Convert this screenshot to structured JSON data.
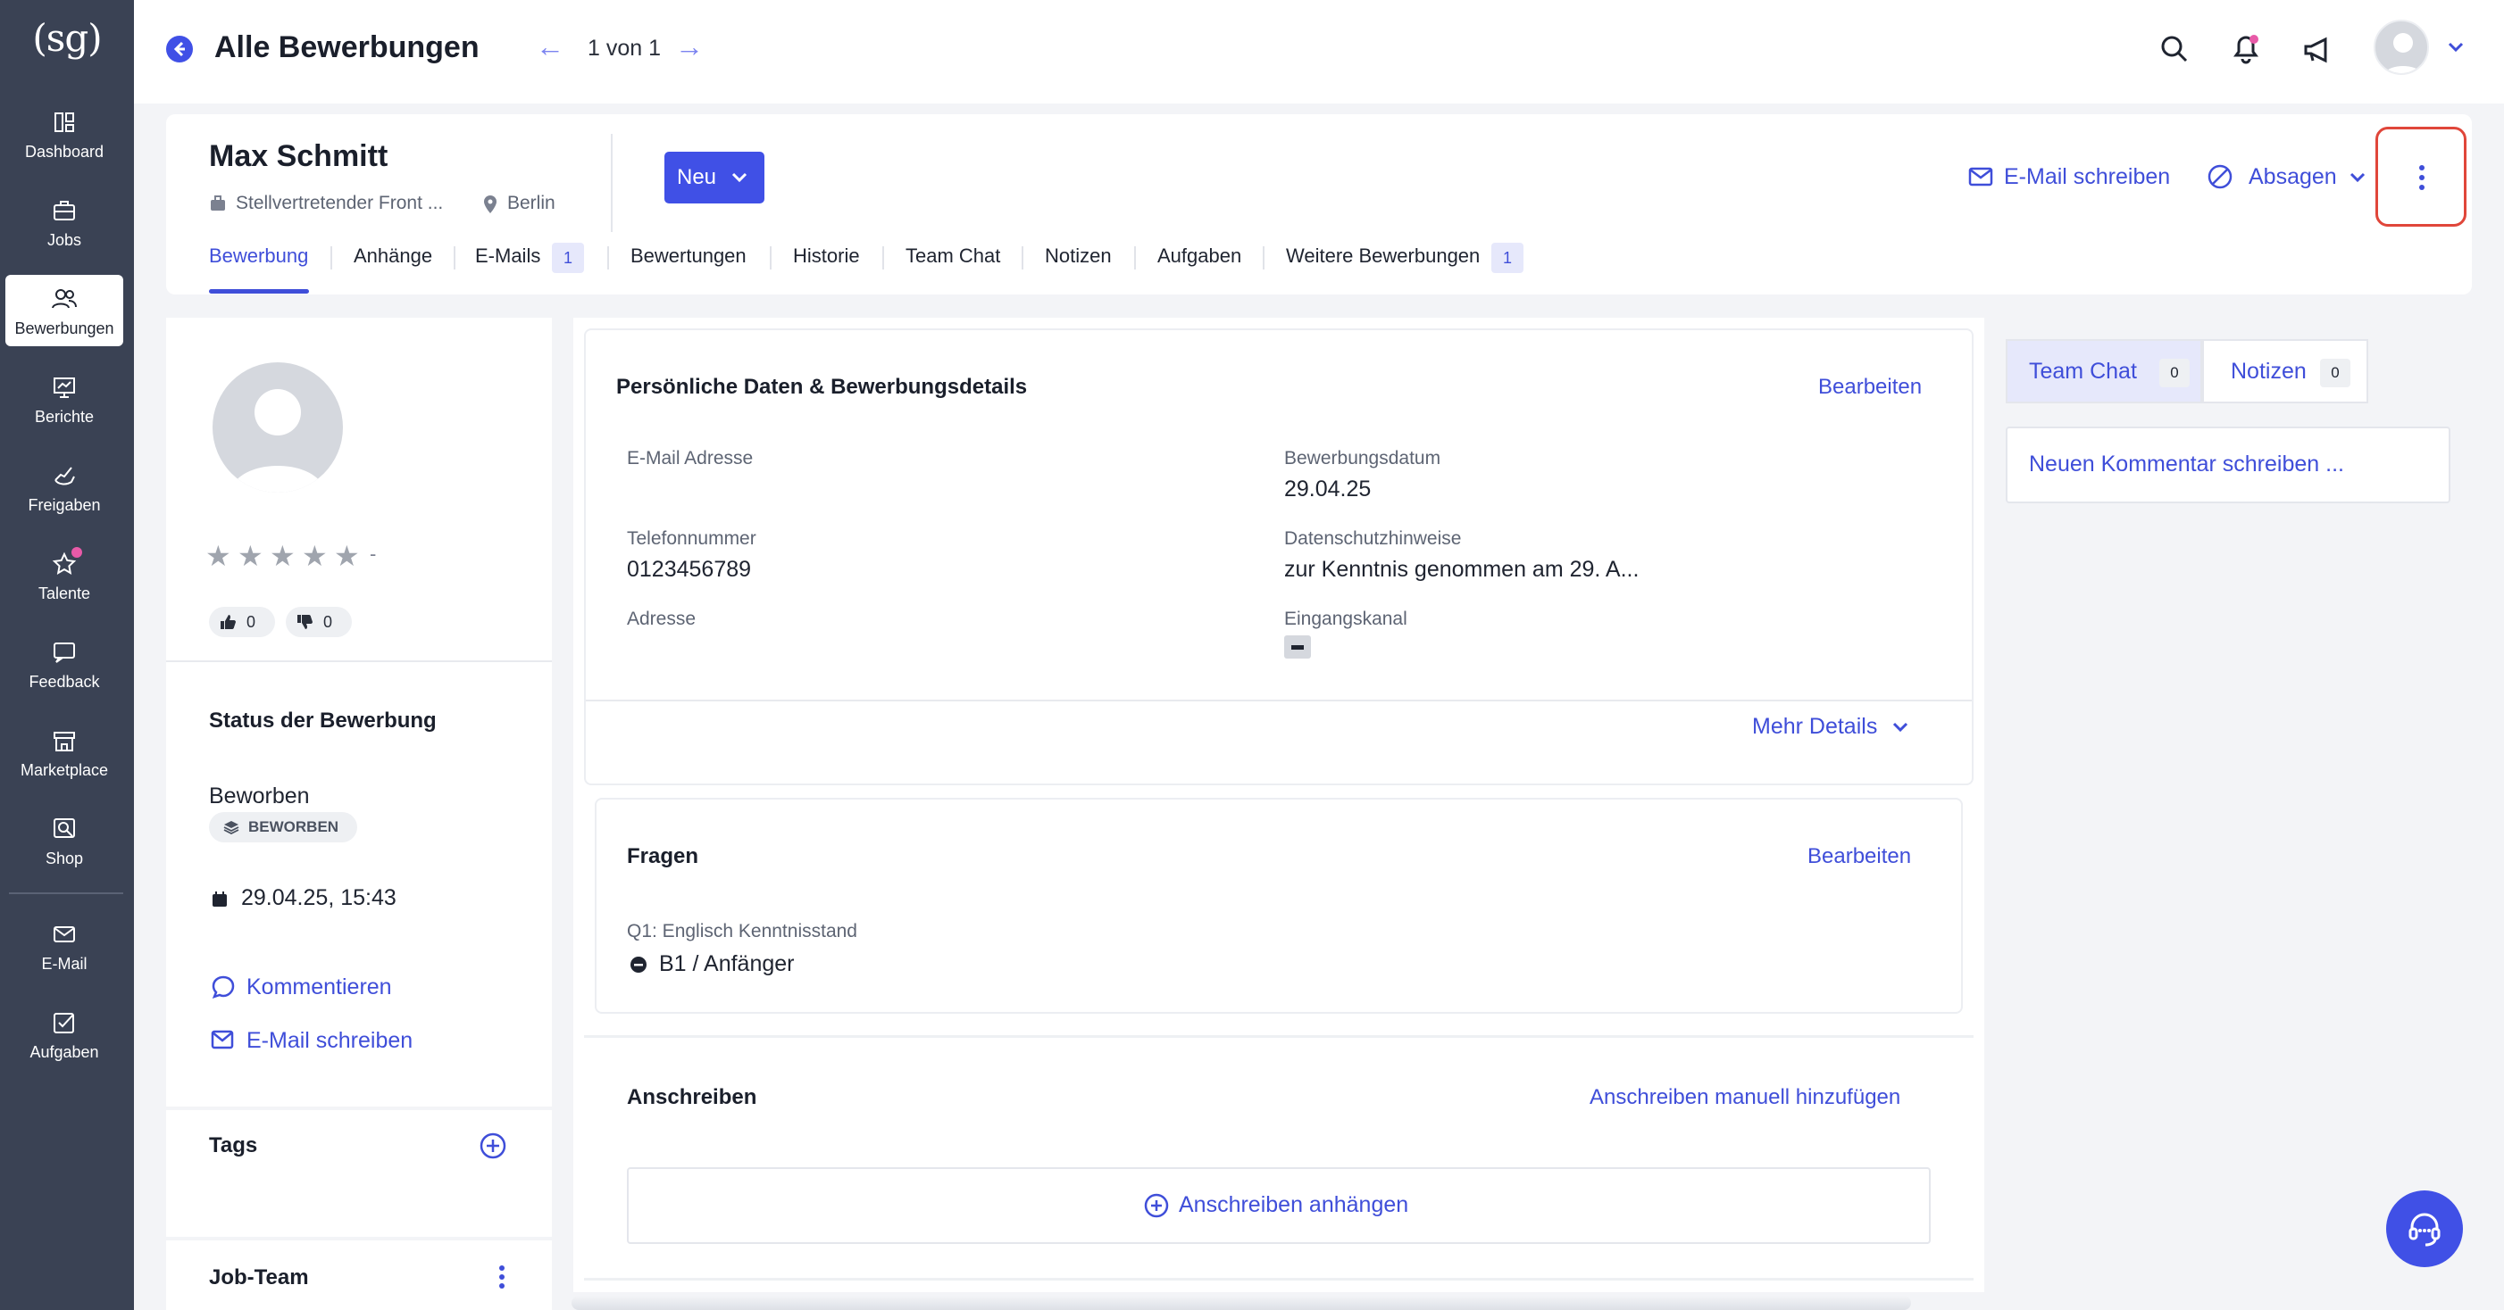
{
  "sidebar": {
    "logo": "(sg)",
    "items": [
      {
        "label": "Dashboard",
        "icon": "dashboard-icon"
      },
      {
        "label": "Jobs",
        "icon": "briefcase-icon"
      },
      {
        "label": "Bewerbungen",
        "icon": "users-icon",
        "active": true
      },
      {
        "label": "Berichte",
        "icon": "chart-icon"
      },
      {
        "label": "Freigaben",
        "icon": "hand-icon"
      },
      {
        "label": "Talente",
        "icon": "star-icon"
      },
      {
        "label": "Feedback",
        "icon": "feedback-icon"
      },
      {
        "label": "Marketplace",
        "icon": "store-icon"
      },
      {
        "label": "Shop",
        "icon": "shop-icon"
      },
      {
        "label": "E-Mail",
        "icon": "mail-icon"
      },
      {
        "label": "Aufgaben",
        "icon": "task-icon"
      }
    ]
  },
  "topbar": {
    "title": "Alle Bewerbungen",
    "pager": "1 von 1"
  },
  "candidate": {
    "name": "Max Schmitt",
    "position": "Stellvertretender Front ...",
    "location": "Berlin",
    "status_button": "Neu",
    "email_action": "E-Mail schreiben",
    "reject_action": "Absagen"
  },
  "tabs": [
    {
      "label": "Bewerbung",
      "active": true
    },
    {
      "label": "Anhänge"
    },
    {
      "label": "E-Mails",
      "badge": "1"
    },
    {
      "label": "Bewertungen"
    },
    {
      "label": "Historie"
    },
    {
      "label": "Team Chat"
    },
    {
      "label": "Notizen"
    },
    {
      "label": "Aufgaben"
    },
    {
      "label": "Weitere Bewerbungen",
      "badge": "1"
    }
  ],
  "left": {
    "rating_dash": "-",
    "thumbs_up": "0",
    "thumbs_down": "0",
    "status_heading": "Status der Bewerbung",
    "status_value": "Beworben",
    "status_chip": "BEWORBEN",
    "date": "29.04.25, 15:43",
    "comment_link": "Kommentieren",
    "email_link": "E-Mail schreiben",
    "tags_heading": "Tags",
    "jobteam_heading": "Job-Team"
  },
  "details": {
    "heading": "Persönliche Daten & Bewerbungsdetails",
    "edit": "Bearbeiten",
    "email_label": "E-Mail Adresse",
    "phone_label": "Telefonnummer",
    "phone_value": "0123456789",
    "address_label": "Adresse",
    "date_label": "Bewerbungsdatum",
    "date_value": "29.04.25",
    "privacy_label": "Datenschutzhinweise",
    "privacy_value": "zur Kenntnis genommen am 29. A...",
    "channel_label": "Eingangskanal",
    "more": "Mehr Details"
  },
  "questions": {
    "heading": "Fragen",
    "edit": "Bearbeiten",
    "q1_label": "Q1: Englisch Kenntnisstand",
    "q1_value": "B1 / Anfänger"
  },
  "cover": {
    "heading": "Anschreiben",
    "add_manual": "Anschreiben manuell hinzufügen",
    "attach": "Anschreiben anhängen"
  },
  "right": {
    "tab_chat": "Team Chat",
    "tab_chat_count": "0",
    "tab_notes": "Notizen",
    "tab_notes_count": "0",
    "comment_placeholder": "Neuen Kommentar schreiben ..."
  },
  "colors": {
    "accent": "#4050e6",
    "sidebar": "#3a4254",
    "highlight": "#e0463a"
  }
}
